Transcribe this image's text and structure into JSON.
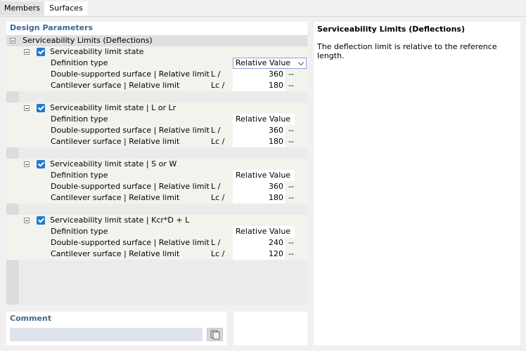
{
  "tabs": [
    {
      "label": "Members",
      "active": true
    },
    {
      "label": "Surfaces",
      "active": false
    }
  ],
  "design_parameters": {
    "title": "Design Parameters",
    "root_label": "Serviceability Limits (Deflections)",
    "groups": [
      {
        "label": "Serviceability limit state",
        "checked": true,
        "definition_label": "Definition type",
        "definition_value": "Relative Value",
        "double_label": "Double-supported surface | Relative limit",
        "double_symbol": "L /",
        "double_value": "360",
        "double_unit": "--",
        "cant_label": "Cantilever surface | Relative limit",
        "cant_symbol": "Lc /",
        "cant_value": "180",
        "cant_unit": "--"
      },
      {
        "label": "Serviceability limit state | L or Lr",
        "checked": true,
        "definition_label": "Definition type",
        "definition_value": "Relative Value",
        "double_label": "Double-supported surface | Relative limit",
        "double_symbol": "L /",
        "double_value": "360",
        "double_unit": "--",
        "cant_label": "Cantilever surface | Relative limit",
        "cant_symbol": "Lc /",
        "cant_value": "180",
        "cant_unit": "--"
      },
      {
        "label": "Serviceability limit state | S or W",
        "checked": true,
        "definition_label": "Definition type",
        "definition_value": "Relative Value",
        "double_label": "Double-supported surface | Relative limit",
        "double_symbol": "L /",
        "double_value": "360",
        "double_unit": "--",
        "cant_label": "Cantilever surface | Relative limit",
        "cant_symbol": "Lc /",
        "cant_value": "180",
        "cant_unit": "--"
      },
      {
        "label": "Serviceability limit state | Kcr*D + L",
        "checked": true,
        "definition_label": "Definition type",
        "definition_value": "Relative Value",
        "double_label": "Double-supported surface | Relative limit",
        "double_symbol": "L /",
        "double_value": "240",
        "double_unit": "--",
        "cant_label": "Cantilever surface | Relative limit",
        "cant_symbol": "Lc /",
        "cant_value": "120",
        "cant_unit": "--"
      }
    ]
  },
  "comment": {
    "title": "Comment",
    "value": "",
    "button_icon": "copy-icon"
  },
  "info": {
    "title": "Serviceability Limits (Deflections)",
    "text": "The deflection limit is relative to the reference length."
  }
}
